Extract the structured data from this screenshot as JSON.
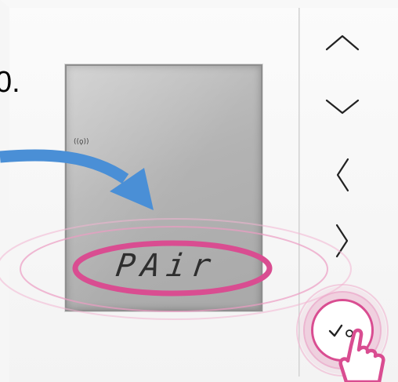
{
  "step": {
    "number": "0."
  },
  "lcd": {
    "status_icon": "wifi-signal-icon",
    "status_glyph": "((ϙ))",
    "display_text": "PAir"
  },
  "buttons": [
    {
      "name": "up-button",
      "icon": "chevron-up-icon"
    },
    {
      "name": "down-button",
      "icon": "chevron-down-icon"
    },
    {
      "name": "left-button",
      "icon": "chevron-left-icon"
    },
    {
      "name": "right-button",
      "icon": "chevron-right-icon"
    },
    {
      "name": "ok-button",
      "icon": "check-icon"
    }
  ],
  "colors": {
    "highlight": "#d94d91",
    "arrow": "#4a8fd6"
  }
}
